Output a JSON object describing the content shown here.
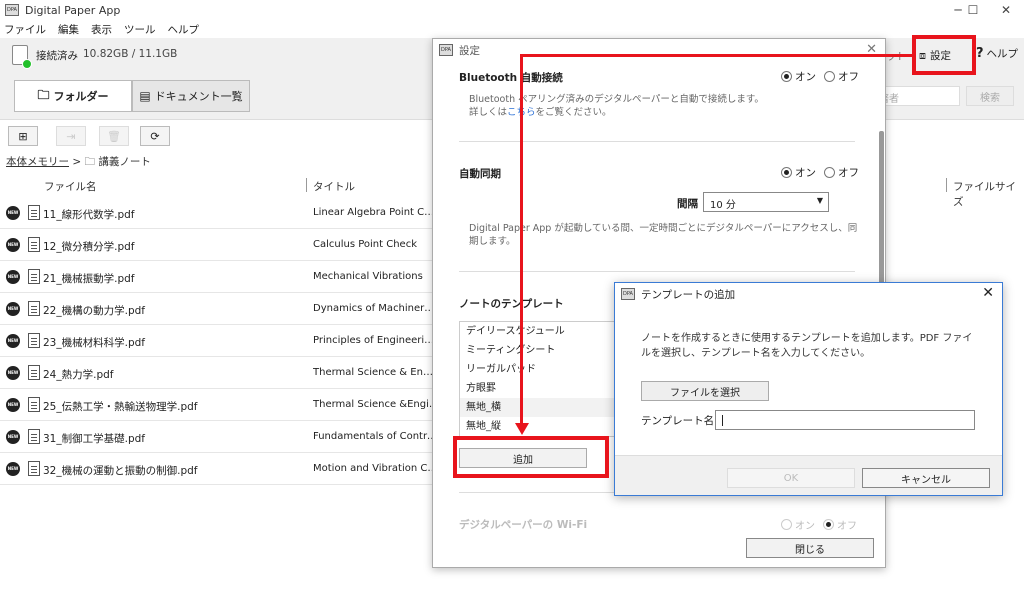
{
  "window": {
    "title": "Digital Paper App",
    "minimize": "─",
    "maximize": "☐",
    "close": "✕"
  },
  "menu": [
    "ファイル",
    "編集",
    "表示",
    "ツール",
    "ヘルプ"
  ],
  "status": {
    "connected": "接続済み",
    "storage": "10.82GB / 11.1GB"
  },
  "tabs": {
    "folder": "フォルダー",
    "documents": "ドキュメント一覧"
  },
  "search": {
    "placeholder": "著者",
    "button": "検索",
    "partial_label": "ット"
  },
  "header_buttons": {
    "settings": "設定",
    "help": "ヘルプ"
  },
  "breadcrumb": {
    "root": "本体メモリー",
    "separator": ">",
    "folder": "講義ノート"
  },
  "columns": {
    "filename": "ファイル名",
    "title": "タイトル",
    "filesize": "ファイルサイズ"
  },
  "files": [
    {
      "name": "11_線形代数学.pdf",
      "title": "Linear Algebra Point Che..."
    },
    {
      "name": "12_微分積分学.pdf",
      "title": "Calculus Point Check"
    },
    {
      "name": "21_機械振動学.pdf",
      "title": "Mechanical Vibrations"
    },
    {
      "name": "22_機構の動力学.pdf",
      "title": "Dynamics of Machinery S..."
    },
    {
      "name": "23_機械材料科学.pdf",
      "title": "Principles of Engineering..."
    },
    {
      "name": "24_熱力学.pdf",
      "title": "Thermal Science & Engin..."
    },
    {
      "name": "25_伝熱工学・熱輸送物理学.pdf",
      "title": "Thermal Science &Engin..."
    },
    {
      "name": "31_制御工学基礎.pdf",
      "title": "Fundamentals of Control ..."
    },
    {
      "name": "32_機械の運動と振動の制御.pdf",
      "title": "Motion and Vibration Con..."
    }
  ],
  "new_badge": "NEW",
  "settings_dialog": {
    "title": "設定",
    "on": "オン",
    "off": "オフ",
    "bluetooth": {
      "title": "Bluetooth 自動接続",
      "desc_line1": "Bluetooth ペアリング済みのデジタルペーパーと自動で接続します。",
      "desc_pre": "詳しくは",
      "desc_link": "こちら",
      "desc_post": "をご覧ください。"
    },
    "autosync": {
      "title": "自動同期",
      "interval_label": "間隔",
      "interval_value": "10 分",
      "desc": "Digital Paper App が起動している間、一定時間ごとにデジタルペーパーにアクセスし、同期します。"
    },
    "templates": {
      "title": "ノートのテンプレート",
      "items": [
        "デイリースケジュール",
        "ミーティングシート",
        "リーガルパッド",
        "方眼罫",
        "無地_横",
        "無地_縦"
      ],
      "add_button": "追加"
    },
    "wifi": {
      "title": "デジタルペーパーの Wi-Fi"
    },
    "close_button": "閉じる"
  },
  "template_dialog": {
    "title": "テンプレートの追加",
    "desc": "ノートを作成するときに使用するテンプレートを追加します。PDF ファイルを選択し、テンプレート名を入力してください。",
    "select_file": "ファイルを選択",
    "name_label": "テンプレート名",
    "name_value": "",
    "ok": "OK",
    "cancel": "キャンセル"
  },
  "annotation_color": "#e8141c"
}
